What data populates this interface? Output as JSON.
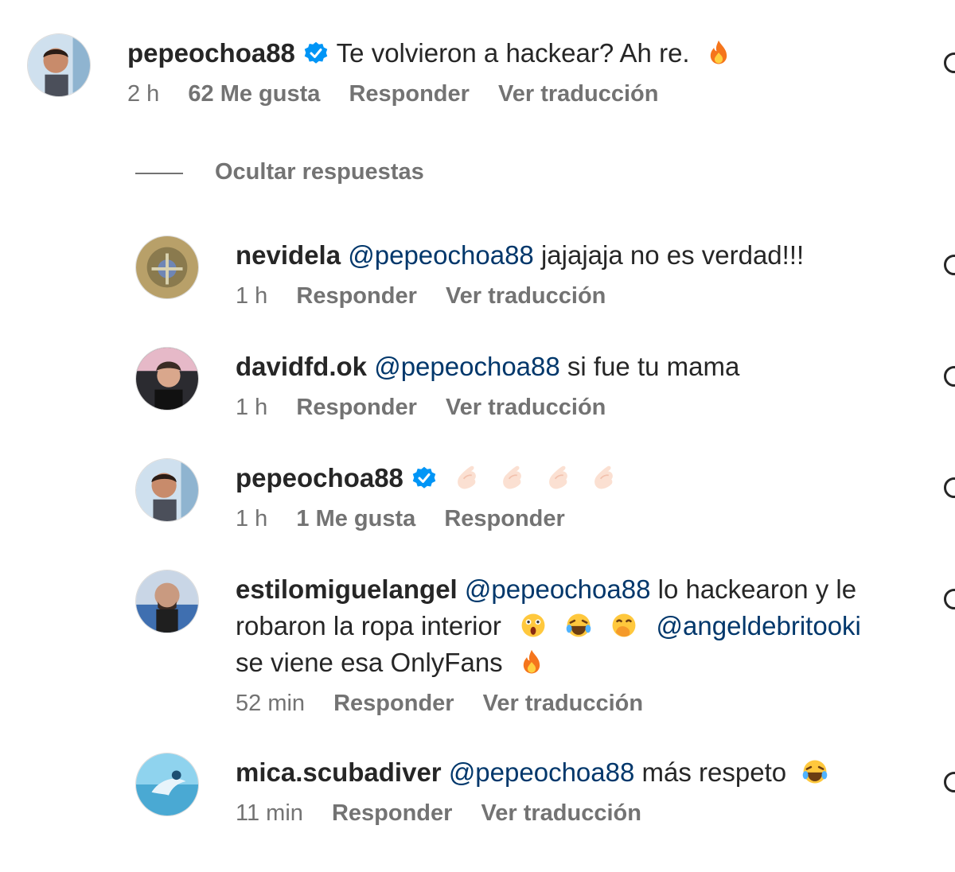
{
  "comment": {
    "username": "pepeochoa88",
    "verified": true,
    "text": "Te volvieron a hackear? Ah re.",
    "emoji": "fire-icon",
    "time": "2 h",
    "likes": "62 Me gusta",
    "reply_label": "Responder",
    "translate_label": "Ver traducción"
  },
  "hide_replies_label": "Ocultar respuestas",
  "replies": [
    {
      "username": "nevidela",
      "mention": "@pepeochoa88",
      "text": "jajajaja no es verdad!!!",
      "time": "1 h",
      "reply_label": "Responder",
      "translate_label": "Ver traducción"
    },
    {
      "username": "davidfd.ok",
      "mention": "@pepeochoa88",
      "text": "si fue tu mama",
      "time": "1 h",
      "reply_label": "Responder",
      "translate_label": "Ver traducción"
    },
    {
      "username": "pepeochoa88",
      "verified": true,
      "emojis": [
        "raised-fist-icon",
        "raised-fist-icon",
        "raised-fist-icon",
        "raised-fist-icon"
      ],
      "time": "1 h",
      "likes": "1 Me gusta",
      "reply_label": "Responder"
    },
    {
      "username": "estilomiguelangel",
      "mention": "@pepeochoa88",
      "text": "lo hackearon y le",
      "line2": "robaron la ropa interior",
      "emojis": [
        "astonished-face-icon",
        "laughing-tears-icon",
        "hand-over-mouth-icon"
      ],
      "mention2": "@angeldebritooki",
      "line3": "se viene esa OnlyFans",
      "emoji3": "fire-icon",
      "time": "52 min",
      "reply_label": "Responder",
      "translate_label": "Ver traducción"
    },
    {
      "username": "mica.scubadiver",
      "mention": "@pepeochoa88",
      "text": "más respeto",
      "emoji": "laughing-tears-icon",
      "time": "11 min",
      "reply_label": "Responder",
      "translate_label": "Ver traducción"
    }
  ],
  "colors": {
    "verified": "#0095f6",
    "mention": "#00376b",
    "meta": "#737373"
  }
}
